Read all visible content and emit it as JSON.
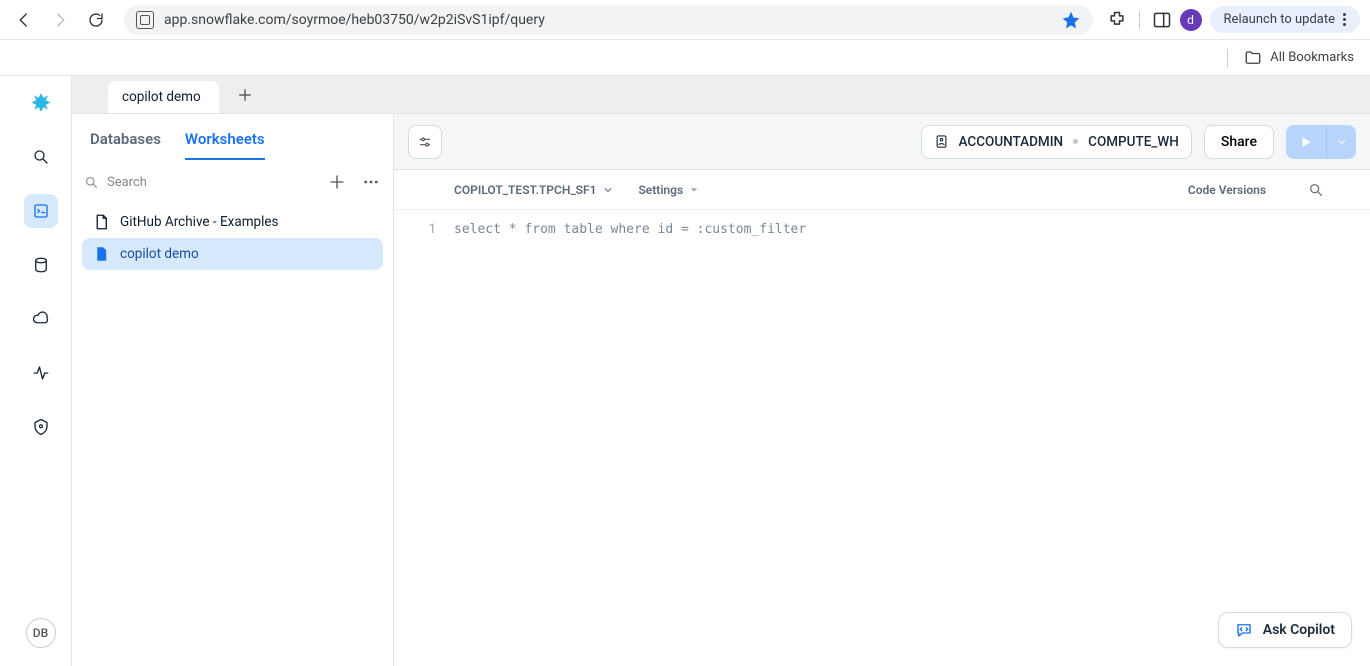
{
  "browser": {
    "url": "app.snowflake.com/soyrmoe/heb03750/w2p2iSvS1ipf/query",
    "relaunch_label": "Relaunch to update",
    "avatar_letter": "d",
    "bookmarks_label": "All Bookmarks"
  },
  "rail": {
    "avatar": "DB"
  },
  "tabs": {
    "active": "copilot demo"
  },
  "sidepanel": {
    "tab_databases": "Databases",
    "tab_worksheets": "Worksheets",
    "search_placeholder": "Search",
    "items": [
      {
        "label": "GitHub Archive - Examples",
        "selected": false
      },
      {
        "label": "copilot demo",
        "selected": true
      }
    ]
  },
  "toolbar": {
    "role": "ACCOUNTADMIN",
    "warehouse": "COMPUTE_WH",
    "share_label": "Share"
  },
  "context": {
    "schema": "COPILOT_TEST.TPCH_SF1",
    "settings_label": "Settings",
    "code_versions_label": "Code Versions"
  },
  "editor": {
    "line": "1",
    "code": "select * from table where id = :custom_filter"
  },
  "copilot": {
    "label": "Ask Copilot"
  }
}
